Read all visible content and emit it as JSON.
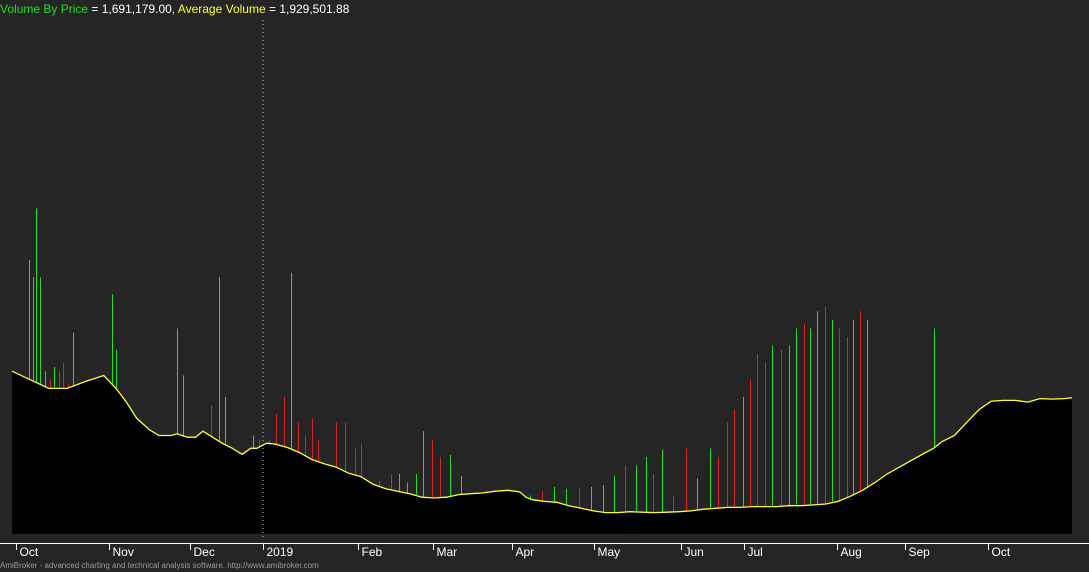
{
  "legend": {
    "vbp_label": "Volume By Price",
    "vbp_value": " = 1,691,179.00, ",
    "avg_label": "Average Volume",
    "avg_value": " = 1,929,501.88"
  },
  "footer": "AmiBroker - advanced charting and technical analysis software. http://www.amibroker.com",
  "colors": {
    "background": "#252525",
    "up_bar": "#22dd22",
    "down_bar": "#dd2222",
    "average_line": "#ffff33",
    "average_fill": "#000000",
    "vbp_label": "#22dd22",
    "avg_label": "#ffff33",
    "value_text": "#ffffff",
    "axis_text": "#ffffff"
  },
  "chart_data": {
    "type": "bar",
    "title": "",
    "xlabel": "",
    "ylabel": "",
    "x_tick_labels": [
      "Oct",
      "Nov",
      "Dec",
      "2019",
      "Feb",
      "Mar",
      "Apr",
      "May",
      "Jun",
      "Jul",
      "Aug",
      "Sep",
      "Oct"
    ],
    "ylim": [
      0,
      6000000
    ],
    "grid": false,
    "series": [
      {
        "name": "Volume By Price",
        "type": "bar",
        "bars": [
          {
            "t": 0.1,
            "v": 800000,
            "up": true
          },
          {
            "t": 0.45,
            "v": 1700000,
            "up": true
          },
          {
            "t": 0.75,
            "v": 1650000,
            "up": false
          },
          {
            "t": 1.05,
            "v": 1750000,
            "up": true
          },
          {
            "t": 1.4,
            "v": 3200000,
            "up": true
          },
          {
            "t": 1.7,
            "v": 3000000,
            "up": true
          },
          {
            "t": 2.0,
            "v": 3800000,
            "up": true
          },
          {
            "t": 2.3,
            "v": 3000000,
            "up": true
          },
          {
            "t": 2.7,
            "v": 1900000,
            "up": true
          },
          {
            "t": 3.1,
            "v": 1800000,
            "up": false
          },
          {
            "t": 3.4,
            "v": 1950000,
            "up": true
          },
          {
            "t": 3.8,
            "v": 1900000,
            "up": false
          },
          {
            "t": 4.2,
            "v": 2000000,
            "up": false
          },
          {
            "t": 4.6,
            "v": 1750000,
            "up": false
          },
          {
            "t": 5.0,
            "v": 2350000,
            "up": true
          },
          {
            "t": 5.4,
            "v": 1550000,
            "up": false
          },
          {
            "t": 8.2,
            "v": 2800000,
            "up": true
          },
          {
            "t": 8.5,
            "v": 2150000,
            "up": true
          },
          {
            "t": 13.5,
            "v": 2400000,
            "up": true
          },
          {
            "t": 14.0,
            "v": 1850000,
            "up": true
          },
          {
            "t": 16.3,
            "v": 1500000,
            "up": false
          },
          {
            "t": 16.9,
            "v": 3000000,
            "up": true
          },
          {
            "t": 17.4,
            "v": 1600000,
            "up": true
          },
          {
            "t": 19.7,
            "v": 1150000,
            "up": true
          },
          {
            "t": 20.2,
            "v": 1100000,
            "up": false
          },
          {
            "t": 21.0,
            "v": 1100000,
            "up": false
          },
          {
            "t": 21.6,
            "v": 1400000,
            "up": false
          },
          {
            "t": 22.2,
            "v": 1600000,
            "up": false
          },
          {
            "t": 22.8,
            "v": 3050000,
            "up": true
          },
          {
            "t": 23.4,
            "v": 1300000,
            "up": false
          },
          {
            "t": 23.9,
            "v": 1150000,
            "up": false
          },
          {
            "t": 24.5,
            "v": 1350000,
            "up": false
          },
          {
            "t": 25.0,
            "v": 1100000,
            "up": false
          },
          {
            "t": 26.5,
            "v": 1300000,
            "up": false
          },
          {
            "t": 27.2,
            "v": 1300000,
            "up": false
          },
          {
            "t": 28.0,
            "v": 1000000,
            "up": false
          },
          {
            "t": 28.5,
            "v": 1050000,
            "up": false
          },
          {
            "t": 29.0,
            "v": 550000,
            "up": true
          },
          {
            "t": 30.0,
            "v": 620000,
            "up": false
          },
          {
            "t": 31.0,
            "v": 700000,
            "up": false
          },
          {
            "t": 31.6,
            "v": 700000,
            "up": true
          },
          {
            "t": 32.3,
            "v": 600000,
            "up": true
          },
          {
            "t": 33.0,
            "v": 700000,
            "up": true
          },
          {
            "t": 33.6,
            "v": 1200000,
            "up": true
          },
          {
            "t": 34.3,
            "v": 1100000,
            "up": false
          },
          {
            "t": 35.0,
            "v": 900000,
            "up": false
          },
          {
            "t": 35.8,
            "v": 920000,
            "up": true
          },
          {
            "t": 36.7,
            "v": 680000,
            "up": true
          },
          {
            "t": 37.6,
            "v": 450000,
            "up": false
          },
          {
            "t": 38.6,
            "v": 430000,
            "up": true
          },
          {
            "t": 39.5,
            "v": 430000,
            "up": true
          },
          {
            "t": 40.5,
            "v": 440000,
            "up": false
          },
          {
            "t": 41.3,
            "v": 480000,
            "up": true
          },
          {
            "t": 42.3,
            "v": 450000,
            "up": true
          },
          {
            "t": 43.3,
            "v": 500000,
            "up": false
          },
          {
            "t": 44.3,
            "v": 550000,
            "up": true
          },
          {
            "t": 45.3,
            "v": 530000,
            "up": true
          },
          {
            "t": 46.3,
            "v": 540000,
            "up": false
          },
          {
            "t": 47.3,
            "v": 550000,
            "up": true
          },
          {
            "t": 48.3,
            "v": 570000,
            "up": true
          },
          {
            "t": 49.2,
            "v": 680000,
            "up": true
          },
          {
            "t": 50.1,
            "v": 800000,
            "up": false
          },
          {
            "t": 51.0,
            "v": 800000,
            "up": true
          },
          {
            "t": 51.8,
            "v": 900000,
            "up": true
          },
          {
            "t": 52.4,
            "v": 700000,
            "up": false
          },
          {
            "t": 53.1,
            "v": 980000,
            "up": true
          },
          {
            "t": 54.0,
            "v": 450000,
            "up": false
          },
          {
            "t": 55.1,
            "v": 1000000,
            "up": false
          },
          {
            "t": 56.0,
            "v": 650000,
            "up": true
          },
          {
            "t": 57.0,
            "v": 1000000,
            "up": true
          },
          {
            "t": 57.7,
            "v": 900000,
            "up": false
          },
          {
            "t": 58.4,
            "v": 1300000,
            "up": false
          },
          {
            "t": 59.0,
            "v": 1450000,
            "up": false
          },
          {
            "t": 59.7,
            "v": 1600000,
            "up": true
          },
          {
            "t": 60.3,
            "v": 1800000,
            "up": false
          },
          {
            "t": 60.9,
            "v": 2100000,
            "up": false
          },
          {
            "t": 61.5,
            "v": 2000000,
            "up": false
          },
          {
            "t": 62.1,
            "v": 2200000,
            "up": true
          },
          {
            "t": 62.8,
            "v": 2150000,
            "up": false
          },
          {
            "t": 63.5,
            "v": 2200000,
            "up": true
          },
          {
            "t": 64.1,
            "v": 2400000,
            "up": true
          },
          {
            "t": 64.7,
            "v": 2450000,
            "up": false
          },
          {
            "t": 65.2,
            "v": 2400000,
            "up": true
          },
          {
            "t": 65.8,
            "v": 2600000,
            "up": true
          },
          {
            "t": 66.4,
            "v": 2650000,
            "up": false
          },
          {
            "t": 67.0,
            "v": 2500000,
            "up": true
          },
          {
            "t": 67.6,
            "v": 2400000,
            "up": false
          },
          {
            "t": 68.2,
            "v": 2300000,
            "up": false
          },
          {
            "t": 68.7,
            "v": 2500000,
            "up": true
          },
          {
            "t": 69.3,
            "v": 2600000,
            "up": false
          },
          {
            "t": 69.9,
            "v": 2500000,
            "up": true
          },
          {
            "t": 75.3,
            "v": 2400000,
            "up": true
          }
        ]
      },
      {
        "name": "Average Volume",
        "type": "area",
        "points": [
          [
            0,
            1900000
          ],
          [
            1.5,
            1800000
          ],
          [
            3.0,
            1700000
          ],
          [
            4.5,
            1700000
          ],
          [
            6.0,
            1780000
          ],
          [
            7.5,
            1850000
          ],
          [
            8.5,
            1700000
          ],
          [
            9.3,
            1550000
          ],
          [
            10.2,
            1350000
          ],
          [
            11.2,
            1220000
          ],
          [
            12.0,
            1150000
          ],
          [
            13.0,
            1150000
          ],
          [
            13.5,
            1170000
          ],
          [
            14.3,
            1130000
          ],
          [
            15.0,
            1130000
          ],
          [
            15.6,
            1200000
          ],
          [
            16.5,
            1120000
          ],
          [
            17.3,
            1050000
          ],
          [
            18.0,
            1000000
          ],
          [
            18.8,
            930000
          ],
          [
            19.5,
            1000000
          ],
          [
            20.0,
            1000000
          ],
          [
            20.8,
            1060000
          ],
          [
            21.5,
            1050000
          ],
          [
            22.5,
            1010000
          ],
          [
            23.5,
            950000
          ],
          [
            24.5,
            870000
          ],
          [
            25.5,
            820000
          ],
          [
            26.5,
            780000
          ],
          [
            27.5,
            710000
          ],
          [
            28.5,
            670000
          ],
          [
            29.5,
            580000
          ],
          [
            30.5,
            530000
          ],
          [
            31.5,
            500000
          ],
          [
            32.5,
            470000
          ],
          [
            33.5,
            430000
          ],
          [
            34.5,
            420000
          ],
          [
            35.5,
            430000
          ],
          [
            36.5,
            460000
          ],
          [
            37.5,
            470000
          ],
          [
            38.5,
            480000
          ],
          [
            39.5,
            500000
          ],
          [
            40.5,
            510000
          ],
          [
            41.5,
            490000
          ],
          [
            42.0,
            430000
          ],
          [
            42.5,
            400000
          ],
          [
            43.5,
            380000
          ],
          [
            44.5,
            370000
          ],
          [
            45.5,
            330000
          ],
          [
            46.5,
            300000
          ],
          [
            47.5,
            270000
          ],
          [
            48.5,
            250000
          ],
          [
            49.5,
            250000
          ],
          [
            50.5,
            260000
          ],
          [
            51.5,
            255000
          ],
          [
            52.5,
            250000
          ],
          [
            53.5,
            255000
          ],
          [
            54.5,
            260000
          ],
          [
            55.5,
            270000
          ],
          [
            56.5,
            290000
          ],
          [
            57.5,
            300000
          ],
          [
            58.5,
            310000
          ],
          [
            59.5,
            310000
          ],
          [
            60.5,
            320000
          ],
          [
            61.5,
            320000
          ],
          [
            62.5,
            320000
          ],
          [
            63.5,
            330000
          ],
          [
            64.5,
            330000
          ],
          [
            65.5,
            340000
          ],
          [
            66.5,
            350000
          ],
          [
            67.5,
            380000
          ],
          [
            68.5,
            440000
          ],
          [
            69.5,
            510000
          ],
          [
            70.5,
            600000
          ],
          [
            71.5,
            700000
          ],
          [
            72.5,
            780000
          ],
          [
            73.5,
            860000
          ],
          [
            74.5,
            940000
          ],
          [
            75.3,
            1000000
          ],
          [
            76.0,
            1080000
          ],
          [
            77.0,
            1150000
          ],
          [
            78.0,
            1300000
          ],
          [
            79.0,
            1450000
          ],
          [
            80.0,
            1550000
          ],
          [
            81.0,
            1560000
          ],
          [
            82.0,
            1560000
          ],
          [
            83.0,
            1540000
          ],
          [
            84.0,
            1580000
          ],
          [
            85.0,
            1575000
          ],
          [
            86.0,
            1580000
          ],
          [
            86.6,
            1590000
          ]
        ]
      }
    ]
  }
}
